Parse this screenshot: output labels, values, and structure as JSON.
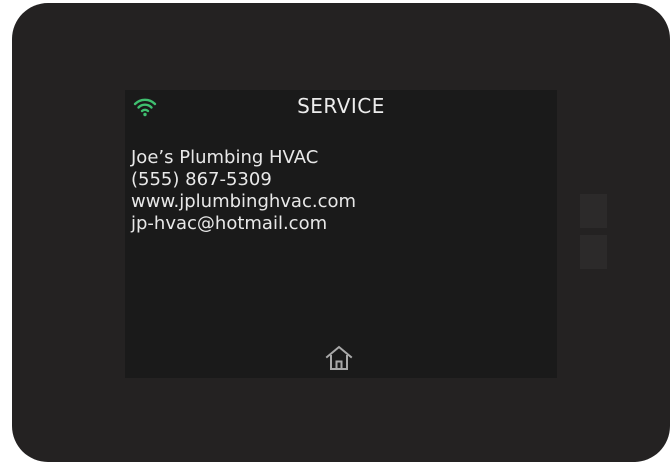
{
  "screen": {
    "title": "SERVICE",
    "status_icon": "wifi-icon",
    "accent_color": "#3fbf6f"
  },
  "service_info": {
    "company": "Joe’s Plumbing HVAC",
    "phone": "(555) 867-5309",
    "website": "www.jplumbinghvac.com",
    "email": "jp-hvac@hotmail.com"
  },
  "navigation": {
    "home_icon": "home-icon"
  },
  "side_buttons": [
    "side-button-up",
    "side-button-down"
  ]
}
